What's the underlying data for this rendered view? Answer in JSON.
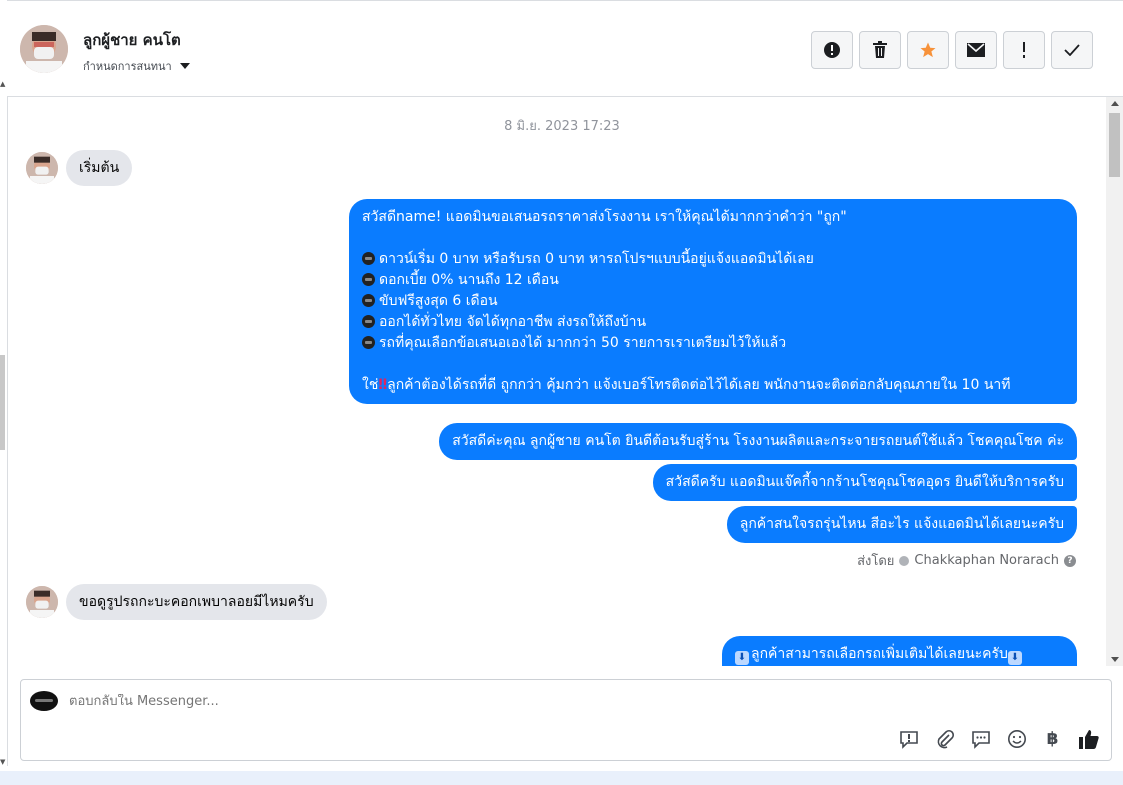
{
  "header": {
    "contact_name": "ลูกผู้ชาย คนโต",
    "conversation_menu": "กำหนดการสนทนา",
    "toolbar": [
      {
        "name": "mark-spam",
        "icon": "exclamation-circle-icon"
      },
      {
        "name": "delete",
        "icon": "trash-icon"
      },
      {
        "name": "star",
        "icon": "star-icon",
        "color": "#f7923a"
      },
      {
        "name": "mark-unread",
        "icon": "envelope-icon"
      },
      {
        "name": "follow-up",
        "icon": "exclamation-icon"
      },
      {
        "name": "done",
        "icon": "check-icon"
      }
    ]
  },
  "thread": {
    "timestamp": "8 มิ.ย. 2023 17:23",
    "messages": [
      {
        "dir": "in",
        "text": "เริ่มต้น"
      },
      {
        "dir": "out",
        "lines": [
          "สวัสดีname! แอดมินขอเสนอรถราคาส่งโรงงาน เราให้คุณได้มากกว่าคำว่า \"ถูก\"",
          "",
          "ดาวน์เริ่ม 0 บาท หรือรับรถ 0 บาท หารถโปรฯแบบนี้อยู่แจ้งแอดมินได้เลย",
          "ดอกเบี้ย 0% นานถึง 12 เดือน",
          "ขับฟรีสูงสุด 6 เดือน",
          "ออกได้ทั่วไทย จัดได้ทุกอาชีพ ส่งรถให้ถึงบ้าน",
          "รถที่คุณเลือกข้อเสนอเองได้ มากกว่า 50 รายการเราเตรียมไว้ให้แล้ว",
          "",
          "ลูกค้าต้องได้รถที่ดี ถูกกว่า คุ้มกว่า แจ้งเบอร์โทรติดต่อไว้ได้เลย พนักงานจะติดต่อกลับคุณภายใน 10 นาที"
        ]
      },
      {
        "dir": "out",
        "text": "สวัสดีค่ะคุณ ลูกผู้ชาย คนโต ยินดีต้อนรับสู่ร้าน โรงงานผลิตและกระจายรถยนต์ใช้แล้ว โชคคุณโชค ค่ะ"
      },
      {
        "dir": "out",
        "text": "สวัสดีครับ แอดมินแจ๊คกี้จากร้านโชคุณโชคอุดร ยินดีให้บริการครับ"
      },
      {
        "dir": "out",
        "text": "ลูกค้าสนใจรถรุ่นไหน สีอะไร แจ้งแอดมินได้เลยนะครับ"
      },
      {
        "dir": "in",
        "text": "ขอดูรูปรถกะบะคอกเพบาลอยมีไหมครับ"
      },
      {
        "dir": "out",
        "text": "ลูกค้าสามารถเลือกรถเพิ่มเติมได้เลยนะครับ"
      }
    ],
    "last_line_prefix": "ใช่",
    "sent_by_label": "ส่งโดย",
    "sent_by_name": "Chakkaphan Norarach"
  },
  "composer": {
    "placeholder": "ตอบกลับใน Messenger...",
    "currency_symbol": "฿",
    "tools": [
      "saved-reply-icon",
      "paperclip-icon",
      "chat-bubbles-icon",
      "smiley-icon",
      "baht-icon",
      "thumbs-up-icon"
    ]
  },
  "colors": {
    "outgoing_bubble": "#0a7cff",
    "incoming_bubble": "#e4e6eb",
    "star": "#f7923a"
  }
}
